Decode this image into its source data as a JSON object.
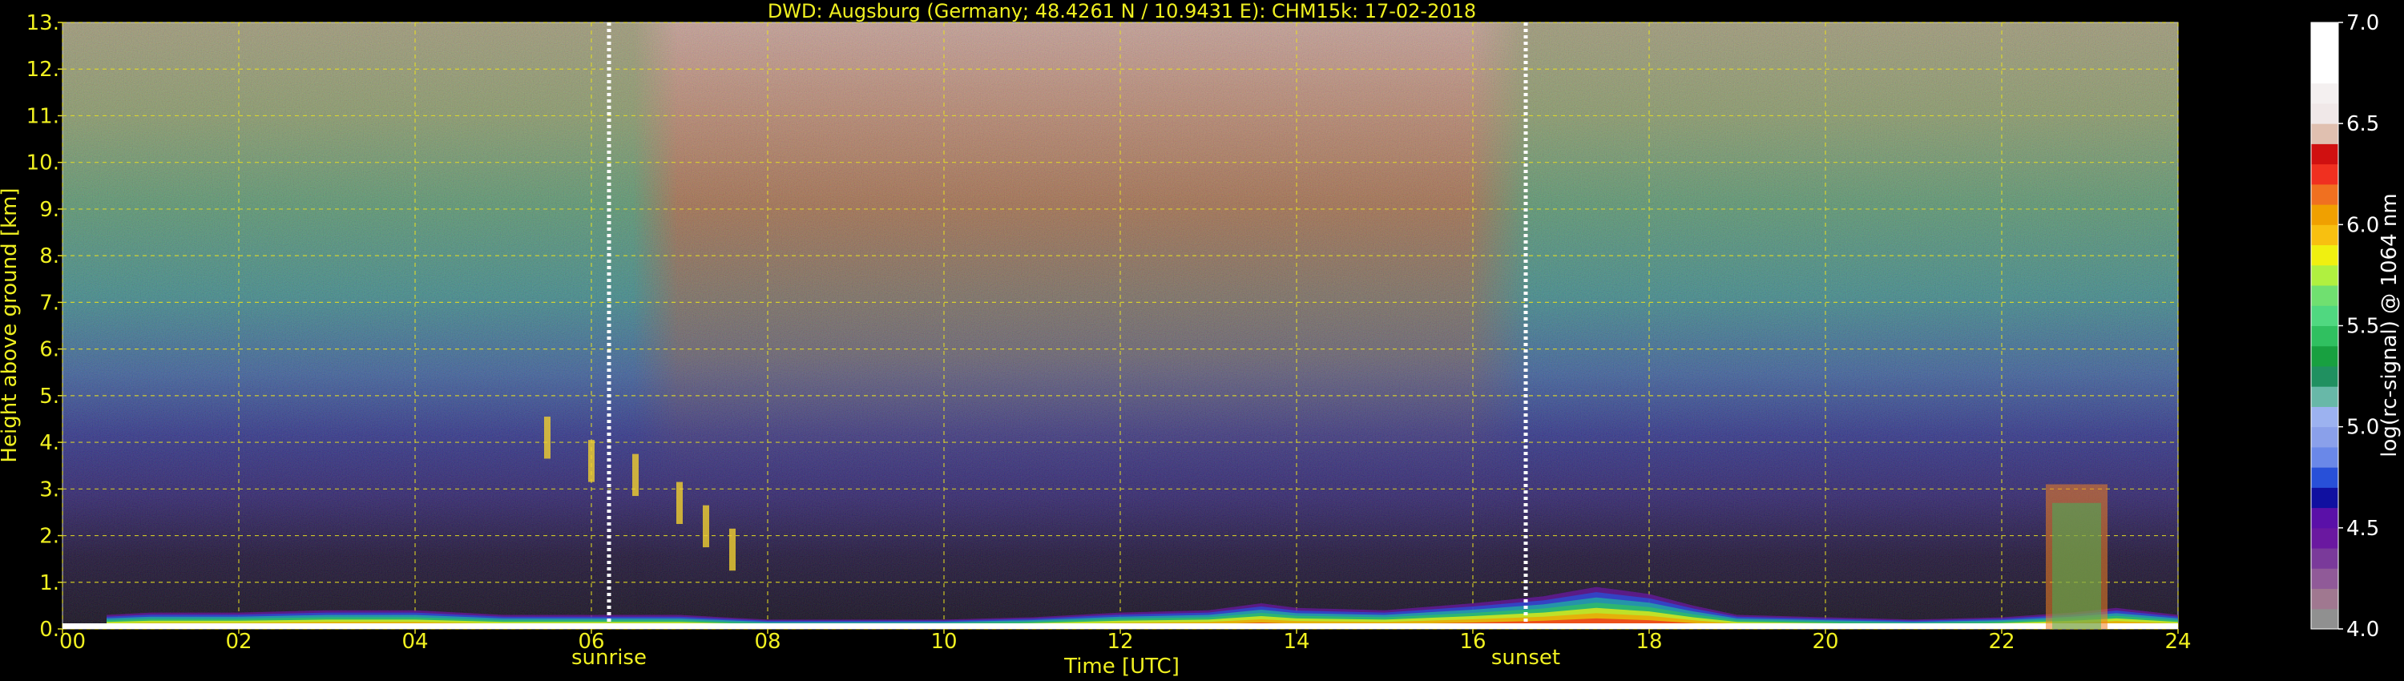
{
  "chart_data": {
    "type": "heatmap",
    "title": "DWD: Augsburg (Germany; 48.4261 N / 10.9431 E):    CHM15k: 17-02-2018",
    "xlabel": "Time [UTC]",
    "ylabel": "Height above ground [km]",
    "xlim": [
      0,
      24
    ],
    "ylim": [
      0,
      13
    ],
    "x_ticks": [
      "00",
      "02",
      "04",
      "06",
      "08",
      "10",
      "12",
      "14",
      "16",
      "18",
      "20",
      "22",
      "24"
    ],
    "y_ticks": [
      "0.",
      "1.",
      "2.",
      "3.",
      "4.",
      "5.",
      "6.",
      "7.",
      "8.",
      "9.",
      "10.",
      "11.",
      "12.",
      "13."
    ],
    "grid": true,
    "events": [
      {
        "label": "sunrise",
        "time": 6.2
      },
      {
        "label": "sunset",
        "time": 16.6
      }
    ],
    "colorbar": {
      "label": "log(rc-signal) @ 1064 nm",
      "range": [
        4.0,
        7.0
      ],
      "ticks": [
        "4.0",
        "4.5",
        "5.0",
        "5.5",
        "6.0",
        "6.5",
        "7.0"
      ],
      "colors": [
        "#909090",
        "#a07890",
        "#905a98",
        "#7a3a9a",
        "#6a18a0",
        "#5a10a8",
        "#1010a0",
        "#2850d8",
        "#6a88e8",
        "#8aa0ea",
        "#9cb2f0",
        "#68b8a8",
        "#209060",
        "#18a040",
        "#30c060",
        "#50d880",
        "#70e070",
        "#b0f040",
        "#f0f010",
        "#f8c010",
        "#f0a000",
        "#f07020",
        "#f03020",
        "#d01010",
        "#e0c0b0",
        "#f0e8e8",
        "#f4f0f0",
        "#ffffff",
        "#ffffff",
        "#ffffff"
      ]
    },
    "layers": [
      {
        "name": "near-surface",
        "points": [
          [
            0.5,
            0.3
          ],
          [
            1,
            0.35
          ],
          [
            2,
            0.35
          ],
          [
            3,
            0.4
          ],
          [
            4,
            0.4
          ],
          [
            5,
            0.3
          ],
          [
            6,
            0.3
          ],
          [
            7,
            0.3
          ],
          [
            8,
            0.2
          ],
          [
            10,
            0.2
          ],
          [
            11,
            0.25
          ],
          [
            12,
            0.35
          ],
          [
            13,
            0.4
          ],
          [
            13.6,
            0.55
          ],
          [
            14,
            0.45
          ],
          [
            15,
            0.4
          ],
          [
            16,
            0.55
          ],
          [
            16.8,
            0.7
          ],
          [
            17.4,
            0.9
          ],
          [
            18,
            0.75
          ],
          [
            18.5,
            0.5
          ],
          [
            19,
            0.3
          ],
          [
            20,
            0.25
          ],
          [
            21,
            0.2
          ],
          [
            22,
            0.25
          ],
          [
            22.8,
            0.35
          ],
          [
            23.3,
            0.45
          ],
          [
            24,
            0.3
          ]
        ]
      },
      {
        "name": "morning-aerosol-streaks",
        "points": [
          [
            5.5,
            4.1
          ],
          [
            6.0,
            3.6
          ],
          [
            6.5,
            3.3
          ],
          [
            7.0,
            2.7
          ],
          [
            7.3,
            2.2
          ],
          [
            7.6,
            1.7
          ]
        ]
      },
      {
        "name": "late-evening-layer",
        "points": [
          [
            22.5,
            3.1
          ],
          [
            23.2,
            3.1
          ]
        ]
      }
    ]
  }
}
